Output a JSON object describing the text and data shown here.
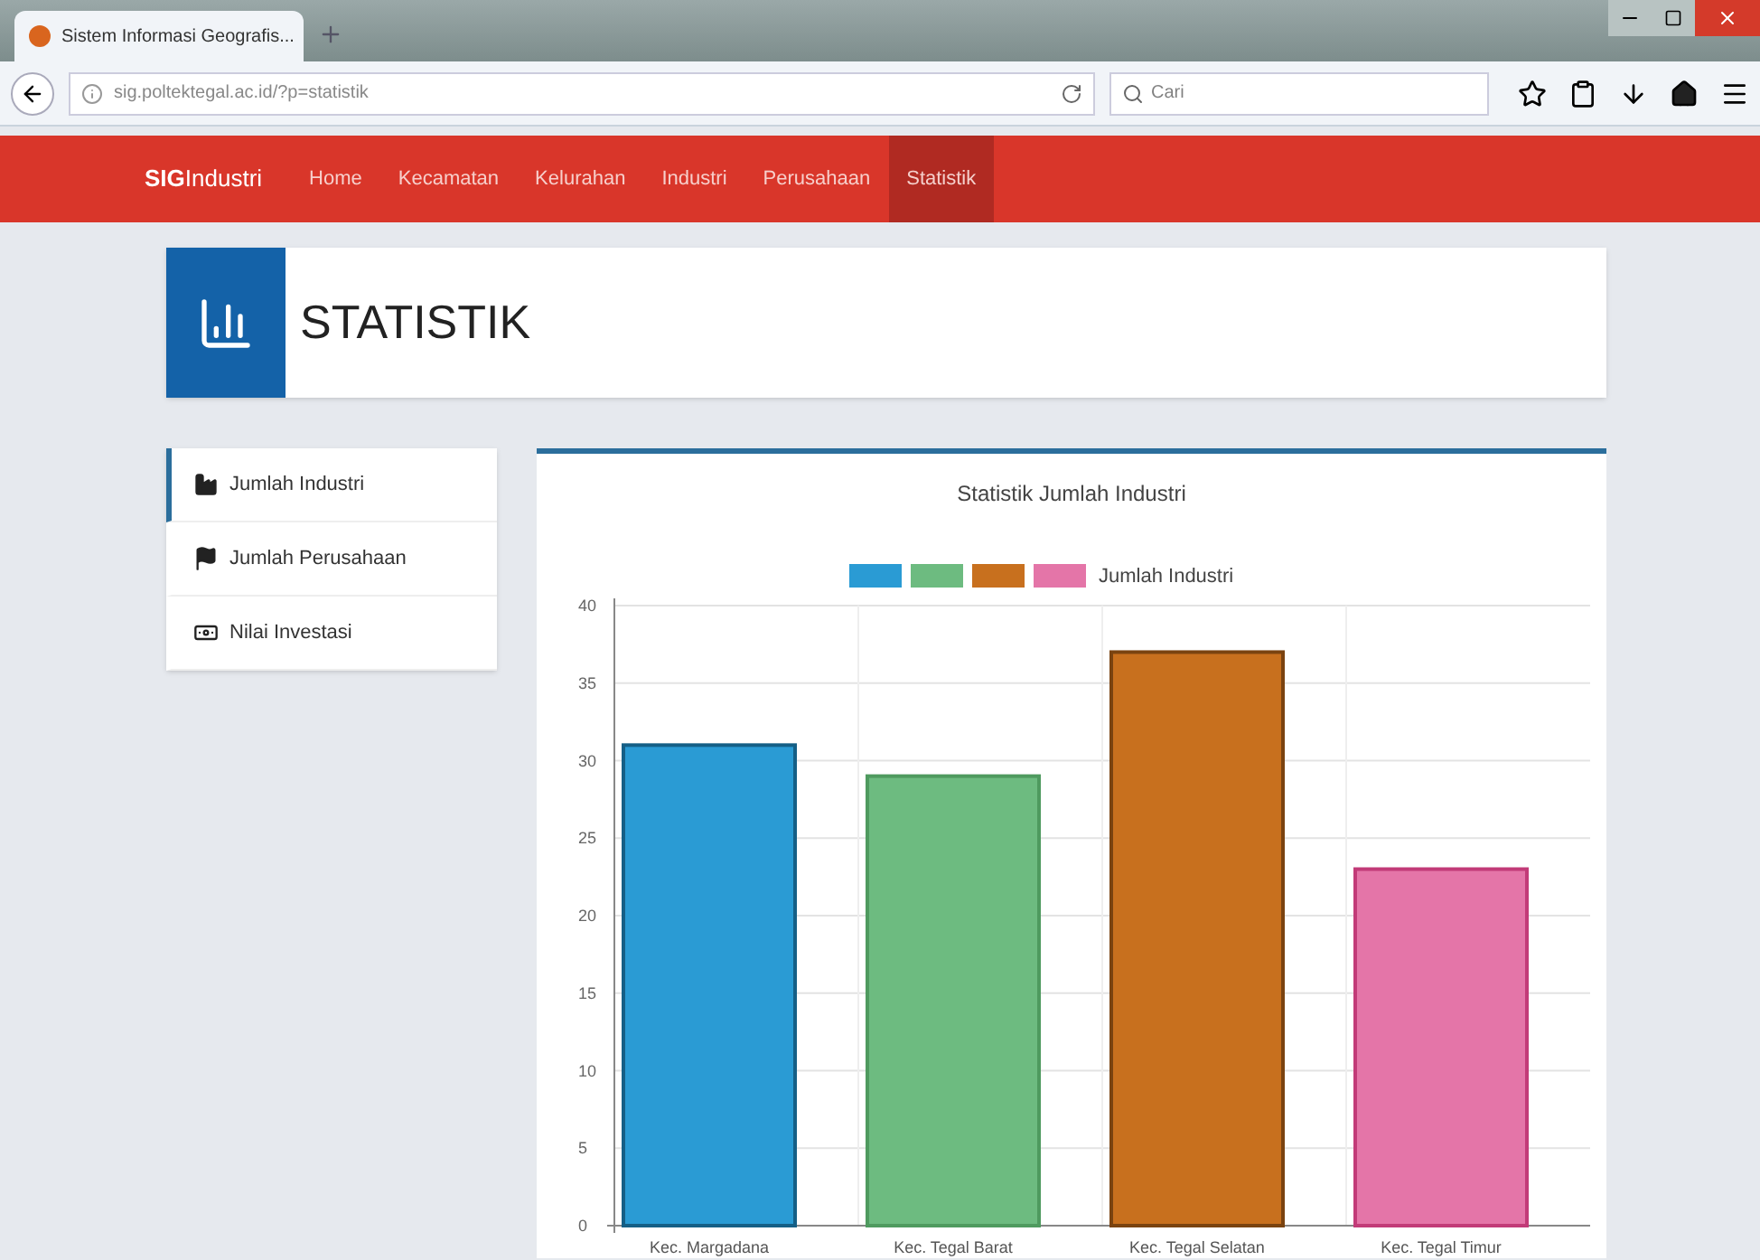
{
  "browser": {
    "tab_title": "Sistem Informasi Geografis...",
    "url": "sig.poltektegal.ac.id/?p=statistik",
    "search": {
      "placeholder": "Cari"
    }
  },
  "navbar": {
    "brand": "**SIG**Industri",
    "items": [
      {
        "label": "Home",
        "selected": false
      },
      {
        "label": "Kecamatan",
        "selected": false
      },
      {
        "label": "Kelurahan",
        "selected": false
      },
      {
        "label": "Industri",
        "selected": false
      },
      {
        "label": "Perusahaan",
        "selected": false
      },
      {
        "label": "Statistik",
        "selected": true
      }
    ]
  },
  "header": {
    "title": "STATISTIK"
  },
  "sidebar": {
    "items": [
      {
        "label": "Jumlah Industri",
        "kind": "factory",
        "selected": true
      },
      {
        "label": "Jumlah Perusahaan",
        "kind": "flag",
        "selected": false
      },
      {
        "label": "Nilai Investasi",
        "kind": "money",
        "selected": false
      }
    ]
  },
  "chart": {
    "chart_data": {
      "type": "bar",
      "title": "Statistik Jumlah Industri",
      "categories": [
        "Kec. Margadana",
        "Kec. Tegal Barat",
        "Kec. Tegal Selatan",
        "Kec. Tegal Timur"
      ],
      "colors": [
        "#2a9bd4",
        "#6dbb80",
        "#c8701e",
        "#e475a8"
      ],
      "series": [
        {
          "name": "Jumlah Industri",
          "values": [
            31,
            29,
            37,
            23
          ]
        }
      ],
      "grid": true,
      "ylim": [
        0,
        40
      ],
      "yticks": [
        0,
        5,
        10,
        15,
        20,
        25,
        30,
        35,
        40
      ]
    }
  }
}
